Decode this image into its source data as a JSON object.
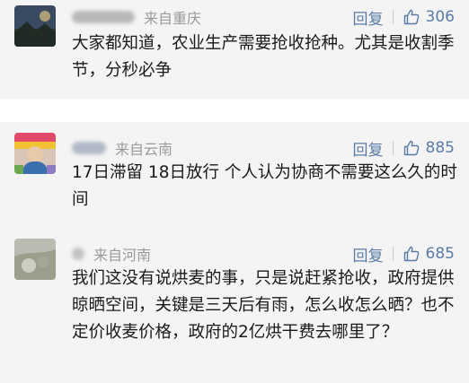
{
  "comments": [
    {
      "location": "来自重庆",
      "reply_label": "回复",
      "like_count": "306",
      "text": "大家都知道，农业生产需要抢收抢种。尤其是收割季节，分秒必争"
    },
    {
      "location": "来自云南",
      "reply_label": "回复",
      "like_count": "885",
      "text": "17日滞留 18日放行 个人认为协商不需要这么久的时间"
    },
    {
      "location": "来自河南",
      "reply_label": "回复",
      "like_count": "685",
      "text": "我们这没有说烘麦的事，只是说赶紧抢收，政府提供晾晒空间，关键是三天后有雨，怎么收怎么晒？也不定价收麦价格，政府的2亿烘干费去哪里了？"
    }
  ],
  "icons": {
    "like": "thumbs-up-icon"
  },
  "colors": {
    "card_background": "#f4f4f4",
    "action_text": "#5a7ba6",
    "meta_text": "#9a9a9a",
    "body_text": "#1a1a1a"
  }
}
